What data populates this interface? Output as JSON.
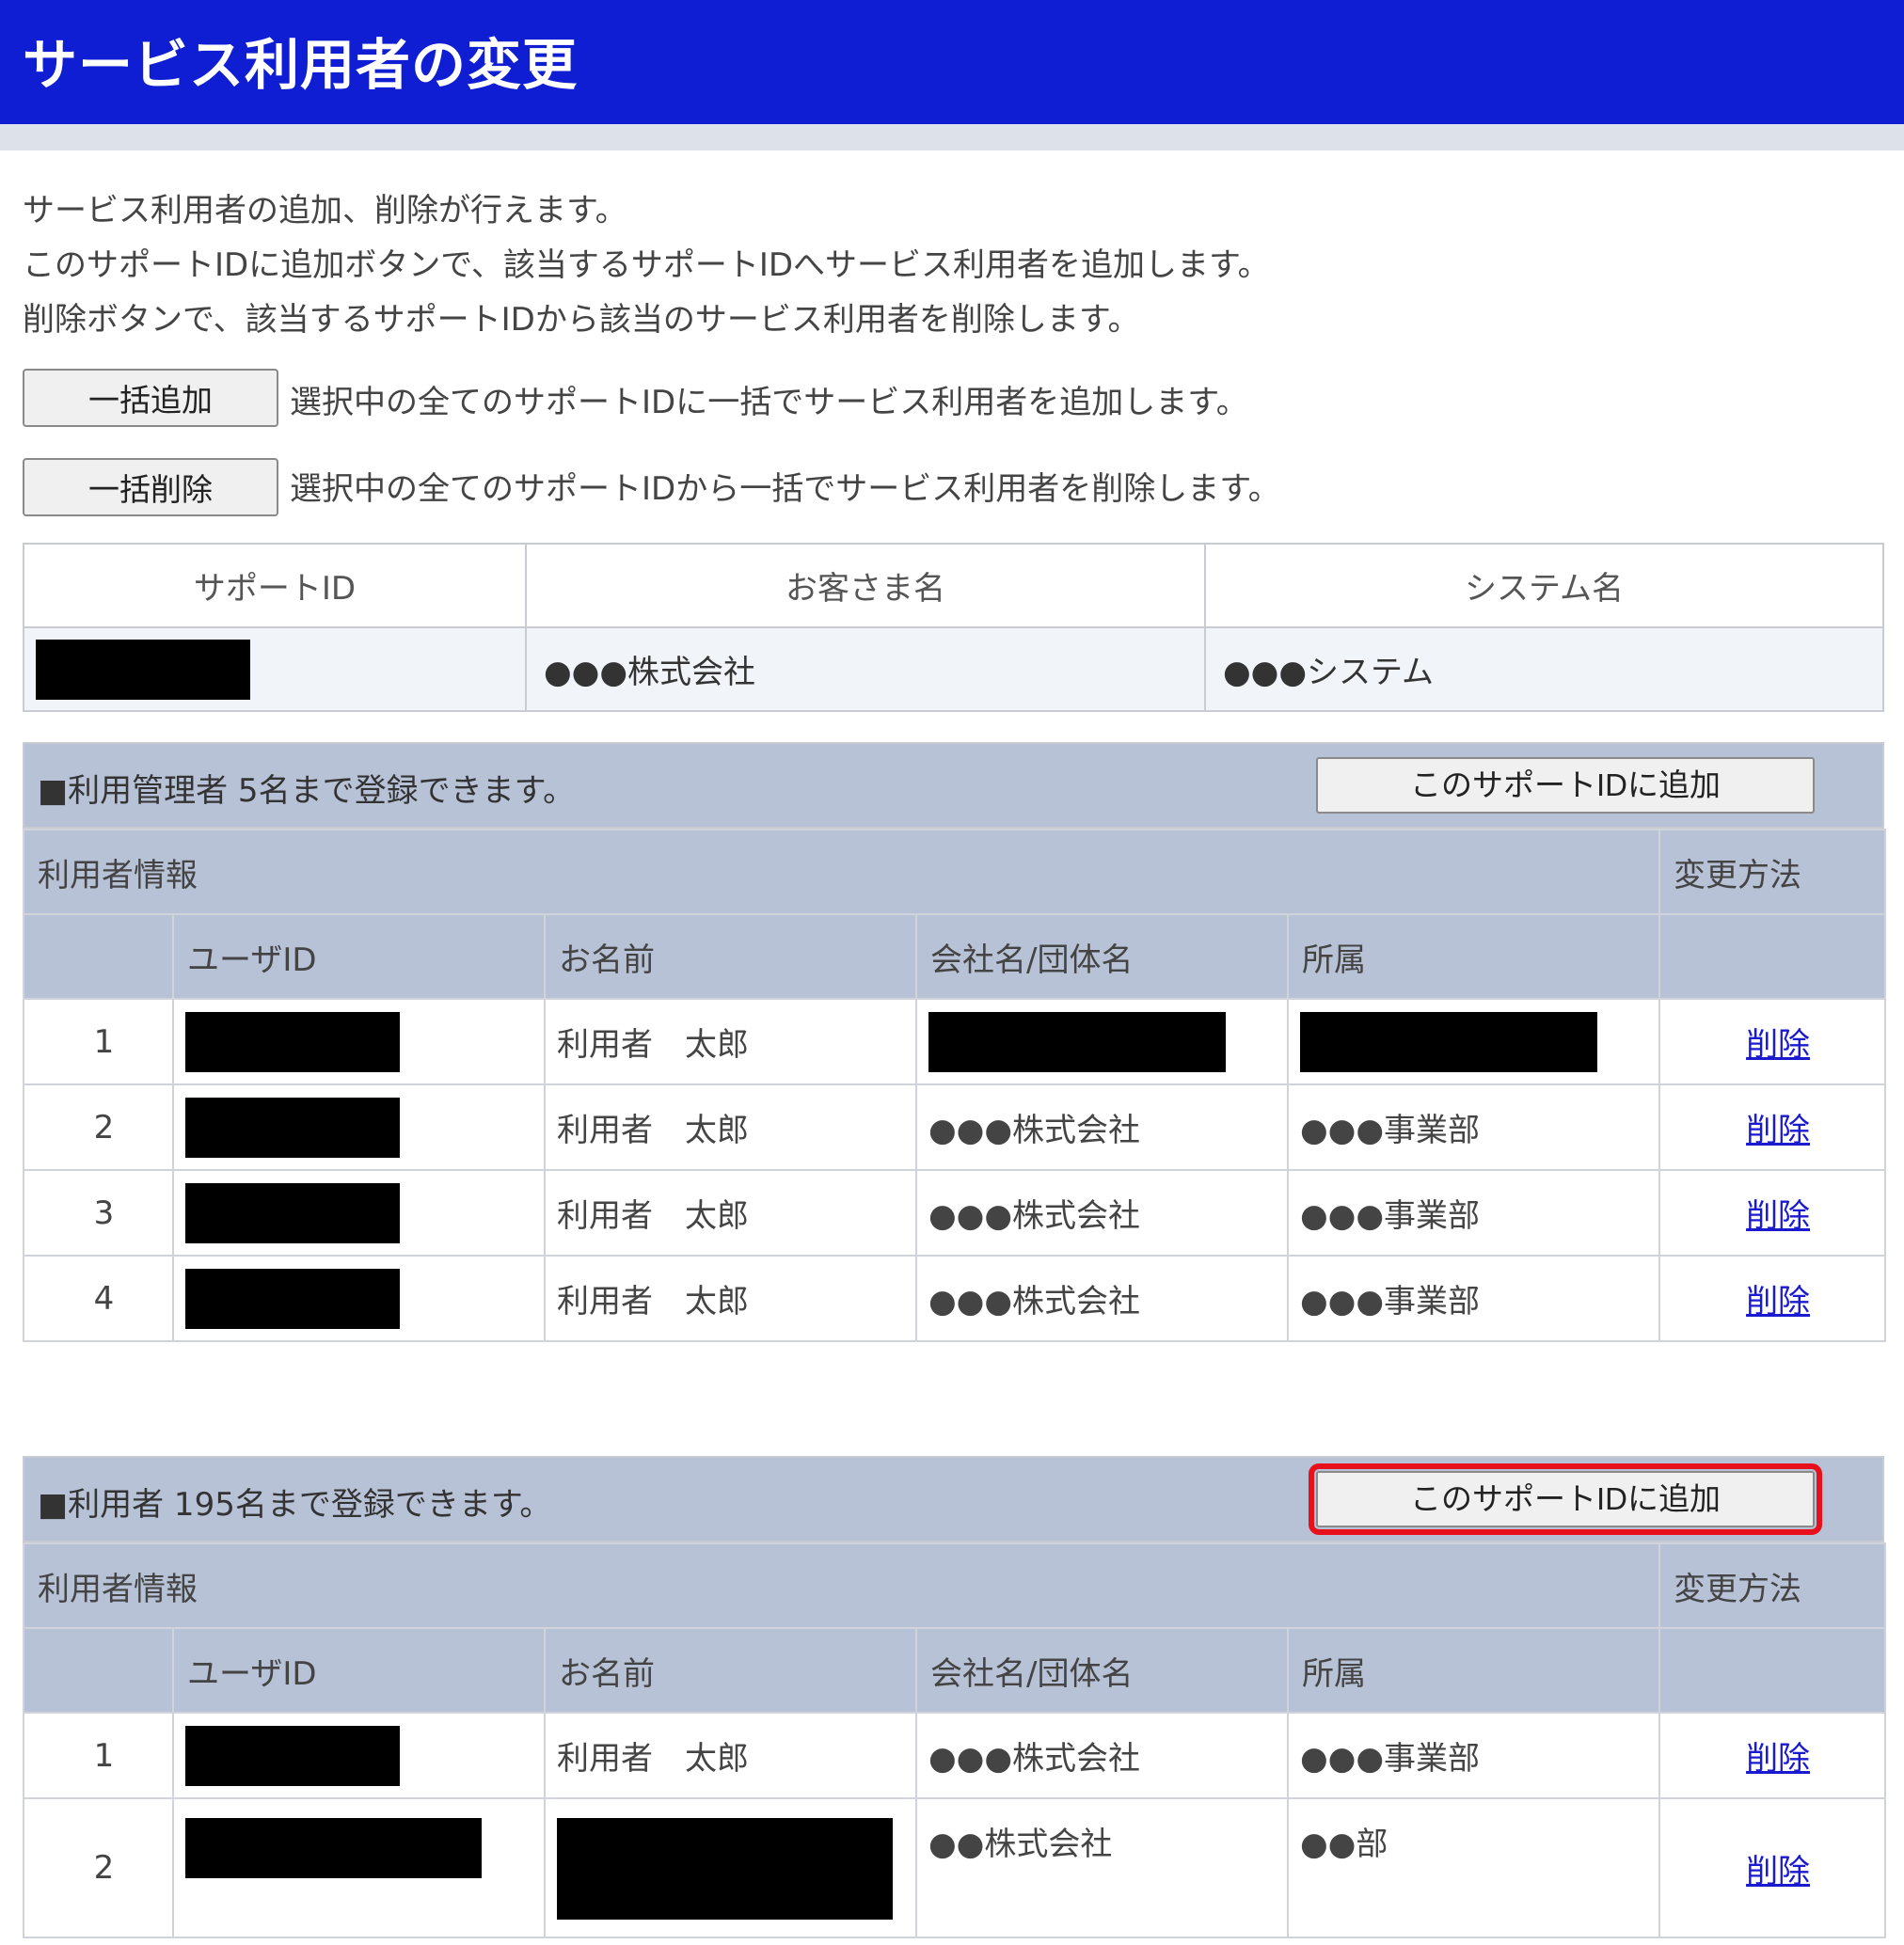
{
  "page": {
    "title": "サービス利用者の変更",
    "description": [
      "サービス利用者の追加、削除が行えます。",
      "このサポートIDに追加ボタンで、該当するサポートIDへサービス利用者を追加します。",
      "削除ボタンで、該当するサポートIDから該当のサービス利用者を削除します。"
    ]
  },
  "bulk": {
    "add_label": "一括追加",
    "add_note": "選択中の全てのサポートIDに一括でサービス利用者を追加します。",
    "delete_label": "一括削除",
    "delete_note": "選択中の全てのサポートIDから一括でサービス利用者を削除します。"
  },
  "support_info": {
    "headers": [
      "サポートID",
      "お客さま名",
      "システム名"
    ],
    "customer_name": "●●●株式会社",
    "system_name": "●●●システム"
  },
  "columns": {
    "user_info": "利用者情報",
    "method": "変更方法",
    "user_id": "ユーザID",
    "name": "お名前",
    "company": "会社名/団体名",
    "department": "所属"
  },
  "admin_section": {
    "title": "■利用管理者  5名まで登録できます。",
    "add_button": "このサポートIDに追加",
    "rows": [
      {
        "no": "1",
        "name": "利用者　太郎",
        "company": "",
        "department": "",
        "action": "削除"
      },
      {
        "no": "2",
        "name": "利用者　太郎",
        "company": "●●●株式会社",
        "department": "●●●事業部",
        "action": "削除"
      },
      {
        "no": "3",
        "name": "利用者　太郎",
        "company": "●●●株式会社",
        "department": "●●●事業部",
        "action": "削除"
      },
      {
        "no": "4",
        "name": "利用者　太郎",
        "company": "●●●株式会社",
        "department": "●●●事業部",
        "action": "削除"
      }
    ]
  },
  "user_section": {
    "title": "■利用者  195名まで登録できます。",
    "add_button": "このサポートIDに追加",
    "highlight_color": "#e8101a",
    "rows": [
      {
        "no": "1",
        "name": "利用者　太郎",
        "company": "●●●株式会社",
        "department": "●●●事業部",
        "action": "削除"
      },
      {
        "no": "2",
        "name": "",
        "company": "●●株式会社",
        "department": "●●部",
        "action": "削除"
      }
    ]
  },
  "colors": {
    "title_bar": "#0f1ed2",
    "section_header": "#b7c2d6",
    "link": "#1a1ad0"
  }
}
